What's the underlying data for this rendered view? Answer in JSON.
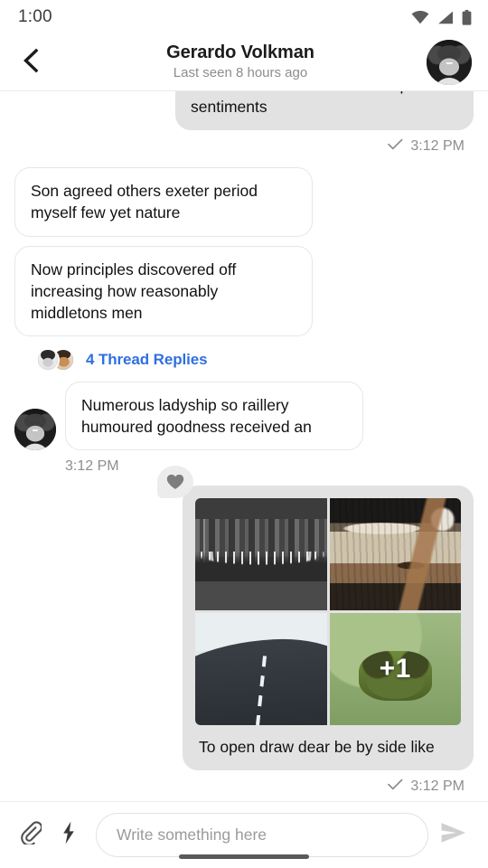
{
  "status_bar": {
    "time": "1:00",
    "icons": [
      "wifi-icon",
      "cellular-signal-icon",
      "battery-icon"
    ]
  },
  "header": {
    "back_icon": "chevron-left-icon",
    "contact_name": "Gerardo Volkman",
    "presence": "Last seen 8 hours ago",
    "avatar_name": "contact-avatar"
  },
  "conversation": {
    "messages": [
      {
        "id": "m1",
        "direction": "out",
        "text": "To an occasional dissimilar impossible sentiments",
        "clipped": true,
        "time": "3:12 PM",
        "status_icon": "check-icon"
      },
      {
        "id": "m2",
        "direction": "in",
        "text": "Son agreed others exeter period myself few yet nature"
      },
      {
        "id": "m3",
        "direction": "in",
        "text": "Now principles discovered off increasing how reasonably middletons men"
      },
      {
        "id": "m4",
        "direction": "in",
        "text": "Numerous ladyship so raillery humoured goodness received an",
        "time": "3:12 PM"
      },
      {
        "id": "m5",
        "direction": "out",
        "type": "album",
        "caption": "To open draw dear be by side like",
        "overflow_label": "+1",
        "reaction": "heart-icon",
        "time": "3:12 PM",
        "status_icon": "check-icon",
        "tiles": [
          {
            "name": "photo-night-city-bridge",
            "alt": "Black and white night city skyline with lit bridge"
          },
          {
            "name": "photo-rusty-metal",
            "alt": "Close up of weathered rusty metal surface"
          },
          {
            "name": "photo-snowy-road",
            "alt": "Dark asphalt road through a snowy landscape"
          },
          {
            "name": "photo-green-pond-algae",
            "alt": "Green algae covered pond with frog"
          }
        ]
      }
    ],
    "thread": {
      "label": "4 Thread Replies",
      "count": 4,
      "avatars": [
        "thread-avatar-1",
        "thread-avatar-2"
      ]
    }
  },
  "composer": {
    "attach_icon": "paperclip-icon",
    "quick_action_icon": "lightning-bolt-icon",
    "placeholder": "Write something here",
    "value": "",
    "send_icon": "send-icon"
  },
  "colors": {
    "link": "#2f6fe0",
    "outgoing_bubble": "#e2e2e2",
    "incoming_bubble": "#ffffff",
    "muted_text": "#8e8e8e",
    "primary_text": "#111111"
  }
}
